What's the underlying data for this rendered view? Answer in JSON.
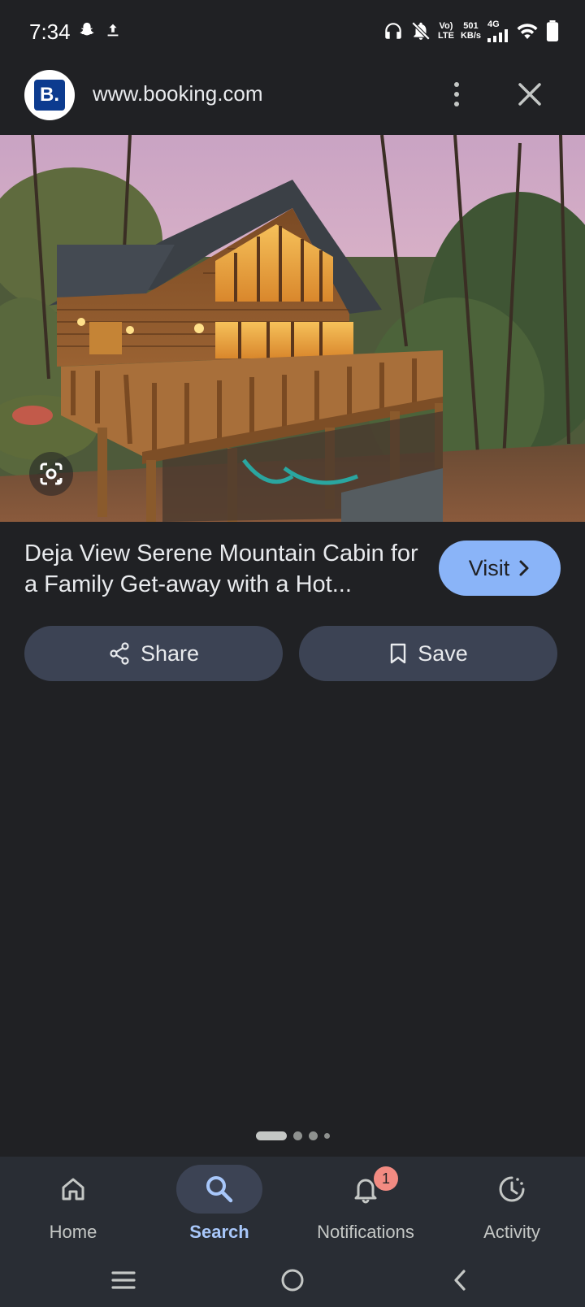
{
  "status_bar": {
    "time": "7:34",
    "network_volte": "Vo)",
    "network_lte": "LTE",
    "speed_value": "501",
    "speed_unit": "KB/s",
    "cell_type": "4G",
    "icons": [
      "snapchat-icon",
      "upload-icon",
      "headphones-icon",
      "mute-icon",
      "signal-icon",
      "wifi-icon",
      "battery-icon"
    ]
  },
  "header": {
    "logo_text": "B.",
    "url": "www.booking.com"
  },
  "result": {
    "title": "Deja View Serene Mountain Cabin for a Family Get-away with a Hot...",
    "visit_label": "Visit",
    "share_label": "Share",
    "save_label": "Save"
  },
  "pagination": {
    "pages": 4,
    "active_index": 0
  },
  "bottom_nav": {
    "items": [
      {
        "label": "Home",
        "icon": "home-icon"
      },
      {
        "label": "Search",
        "icon": "search-icon"
      },
      {
        "label": "Notifications",
        "icon": "bell-icon",
        "badge": "1"
      },
      {
        "label": "Activity",
        "icon": "activity-icon"
      }
    ],
    "active_index": 1
  },
  "colors": {
    "background": "#202124",
    "accent": "#8ab4f8",
    "button_bg": "#3c4354",
    "badge": "#f28b82",
    "logo_blue": "#0c3b8f"
  }
}
